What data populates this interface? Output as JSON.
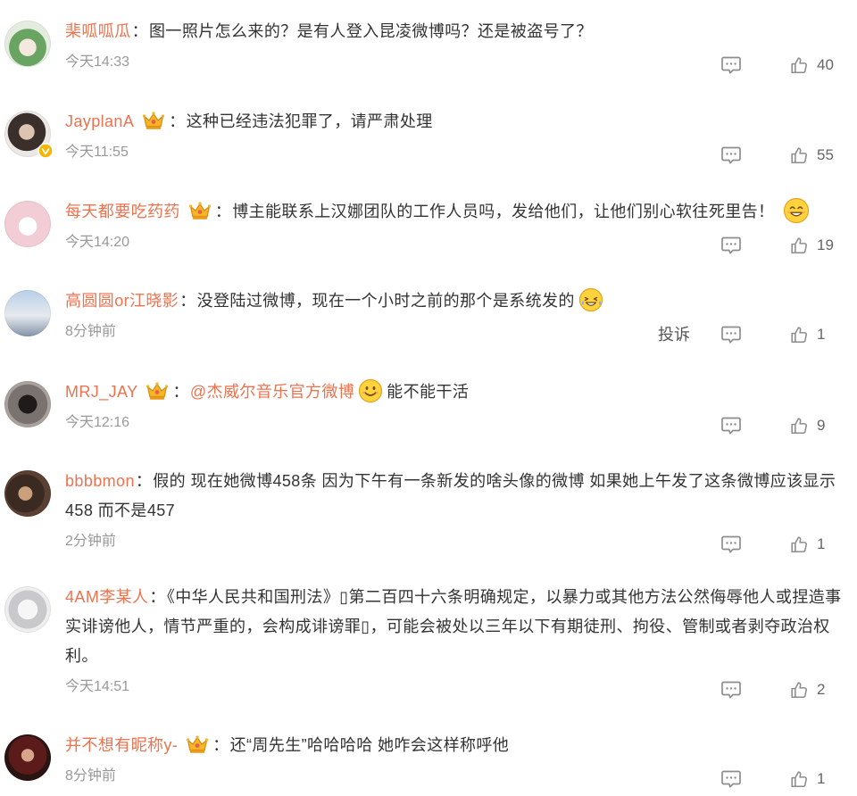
{
  "comments": [
    {
      "user": "棐呱呱瓜",
      "sep": "：",
      "text": "图一照片怎么来的？是有人登入昆凌微博吗？还是被盗号了？",
      "time": "今天14:33",
      "likes": "40"
    },
    {
      "user": "JayplanA",
      "badge": "crown-badge-icon",
      "verified": "verified-badge-icon",
      "sep": "：",
      "text": "这种已经违法犯罪了，请严肃处理",
      "time": "今天11:55",
      "likes": "55"
    },
    {
      "user": "每天都要吃药药",
      "badge": "crown-badge-icon",
      "sep": "：",
      "text": "博主能联系上汉娜团队的工作人员吗，发给他们，让他们别心软往死里告！",
      "emoji": "smile-emoji",
      "time": "今天14:20",
      "likes": "19"
    },
    {
      "user": "高圆圆or江晓影",
      "sep": "：",
      "text": "没登陆过微博，现在一个小时之前的那个是系统发的",
      "emoji": "laugh-tears-emoji",
      "time": "8分钟前",
      "likes": "1",
      "report": "投诉"
    },
    {
      "user": "MRJ_JAY",
      "badge": "crown-badge-icon",
      "sep": "：",
      "mention": "@杰威尔音乐官方微博",
      "emoji": "grin-emoji",
      "text": "能不能干活",
      "time": "今天12:16",
      "likes": "9"
    },
    {
      "user": "bbbbmon",
      "sep": "：",
      "text": "假的 现在她微博458条 因为下午有一条新发的啥头像的微博 如果她上午发了这条微博应该显示458 而不是457",
      "time": "2分钟前",
      "likes": "1"
    },
    {
      "user": "4AM李某人",
      "sep": "：",
      "text": "《中华人民共和国刑法》▯第二百四十六条明确规定，以暴力或其他方法公然侮辱他人或捏造事实诽谤他人，情节严重的，会构成诽谤罪▯，可能会被处以三年以下有期徒刑、拘役、管制或者剥夺政治权利。",
      "time": "今天14:51",
      "likes": "2"
    },
    {
      "user": "并不想有昵称y-",
      "badge": "crown-badge-icon",
      "sep": "：",
      "text": "还“周先生”哈哈哈哈 她咋会这样称呼他",
      "time": "8分钟前",
      "likes": "1"
    }
  ],
  "icons": {
    "reply": "comment-icon",
    "like": "thumbs-up-icon",
    "avatar": "user-avatar"
  },
  "colors": {
    "username": "#eb7350",
    "text": "#333333",
    "meta": "#999999",
    "icon": "#8d8d8d",
    "badge": "#f5b627",
    "verified": "#f7b500"
  }
}
